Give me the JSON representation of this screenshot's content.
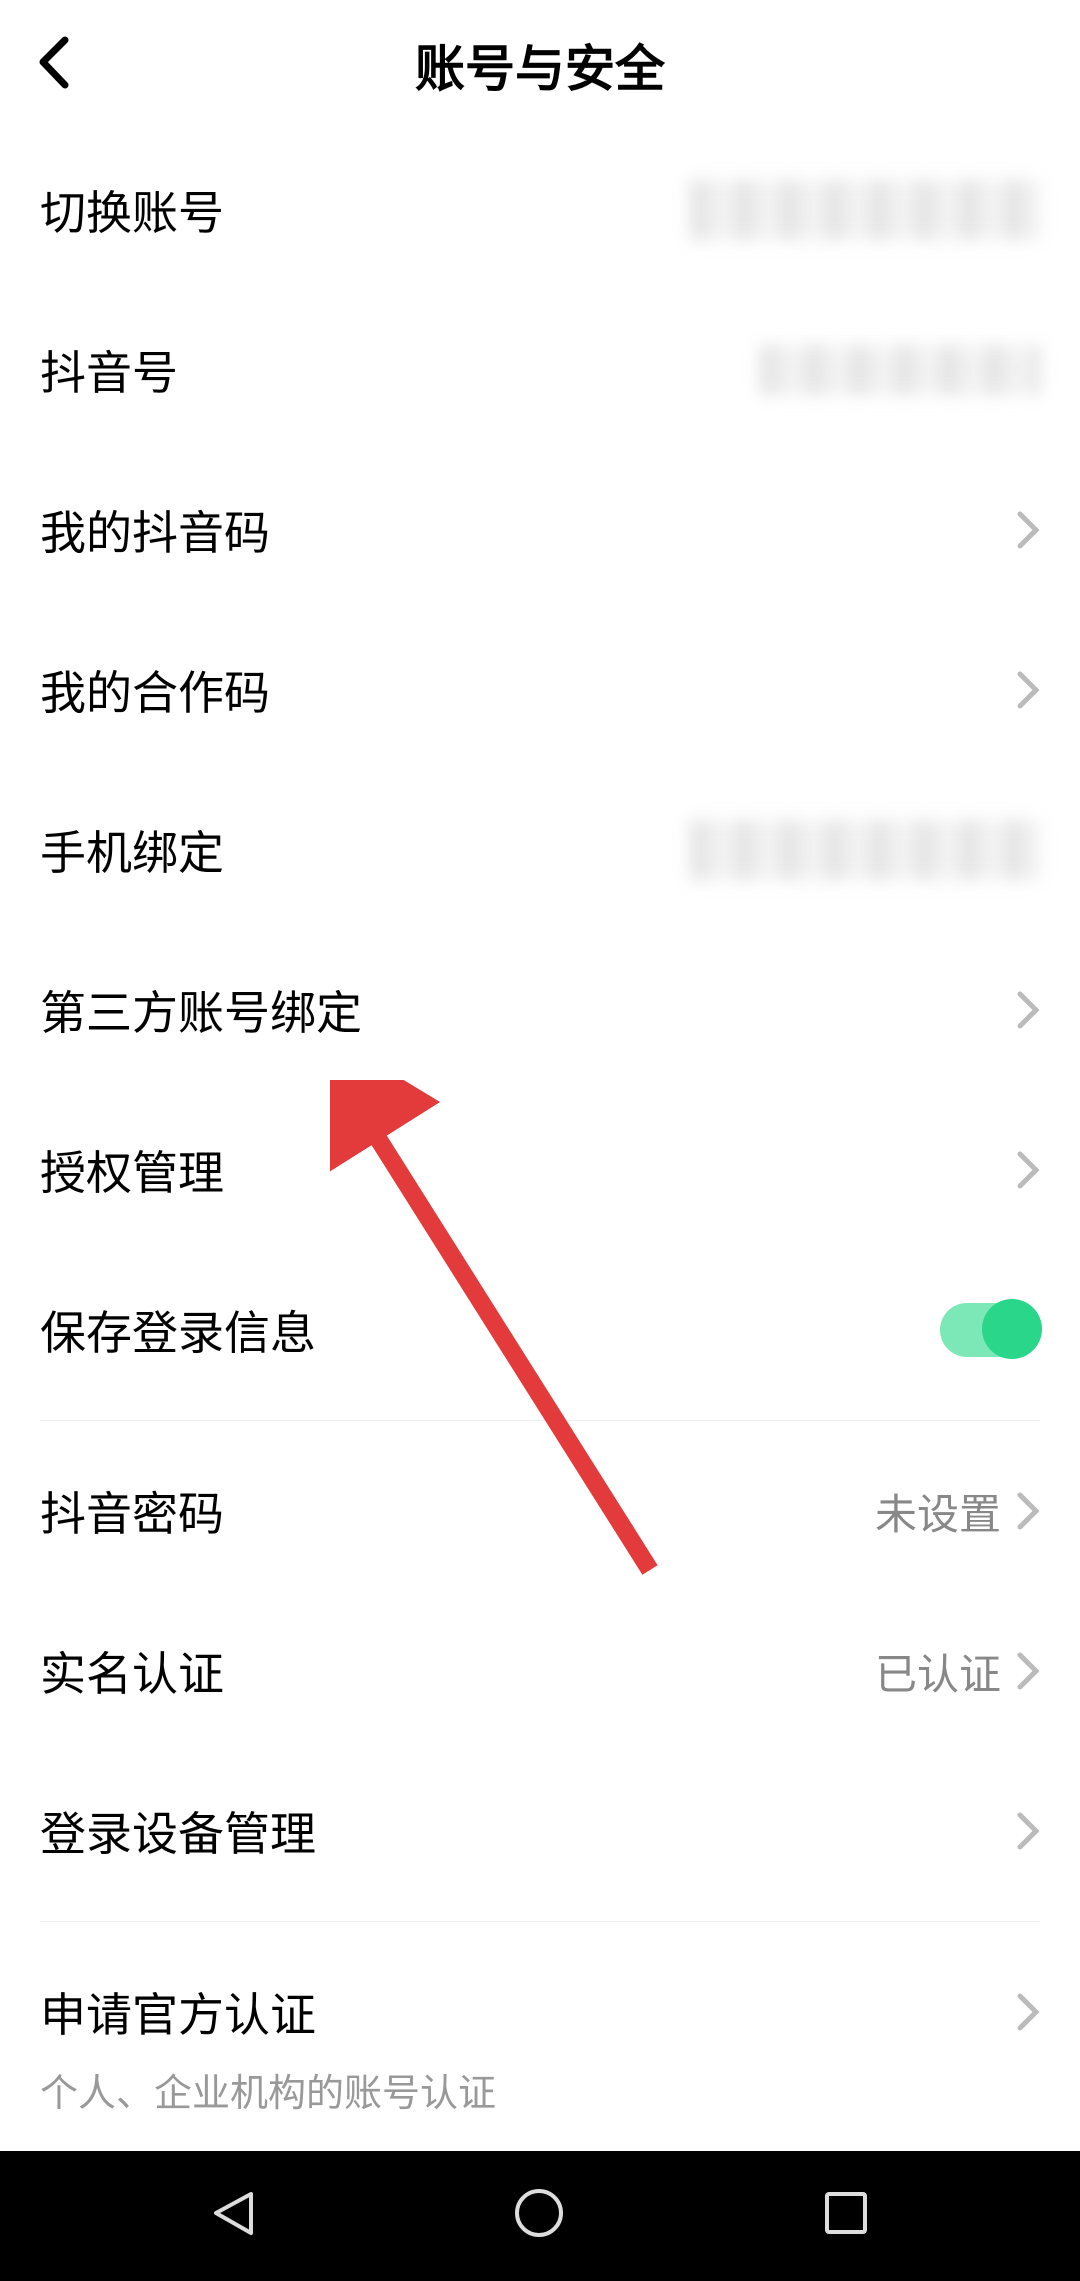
{
  "header": {
    "title": "账号与安全"
  },
  "items": {
    "switch_account": "切换账号",
    "douyin_id": "抖音号",
    "my_douyin_code": "我的抖音码",
    "my_coop_code": "我的合作码",
    "phone_binding": "手机绑定",
    "third_party": "第三方账号绑定",
    "auth_management": "授权管理",
    "save_login": "保存登录信息",
    "douyin_password": "抖音密码",
    "douyin_password_value": "未设置",
    "real_name": "实名认证",
    "real_name_value": "已认证",
    "login_devices": "登录设备管理",
    "official_cert": "申请官方认证",
    "official_cert_sub": "个人、企业机构的账号认证"
  }
}
